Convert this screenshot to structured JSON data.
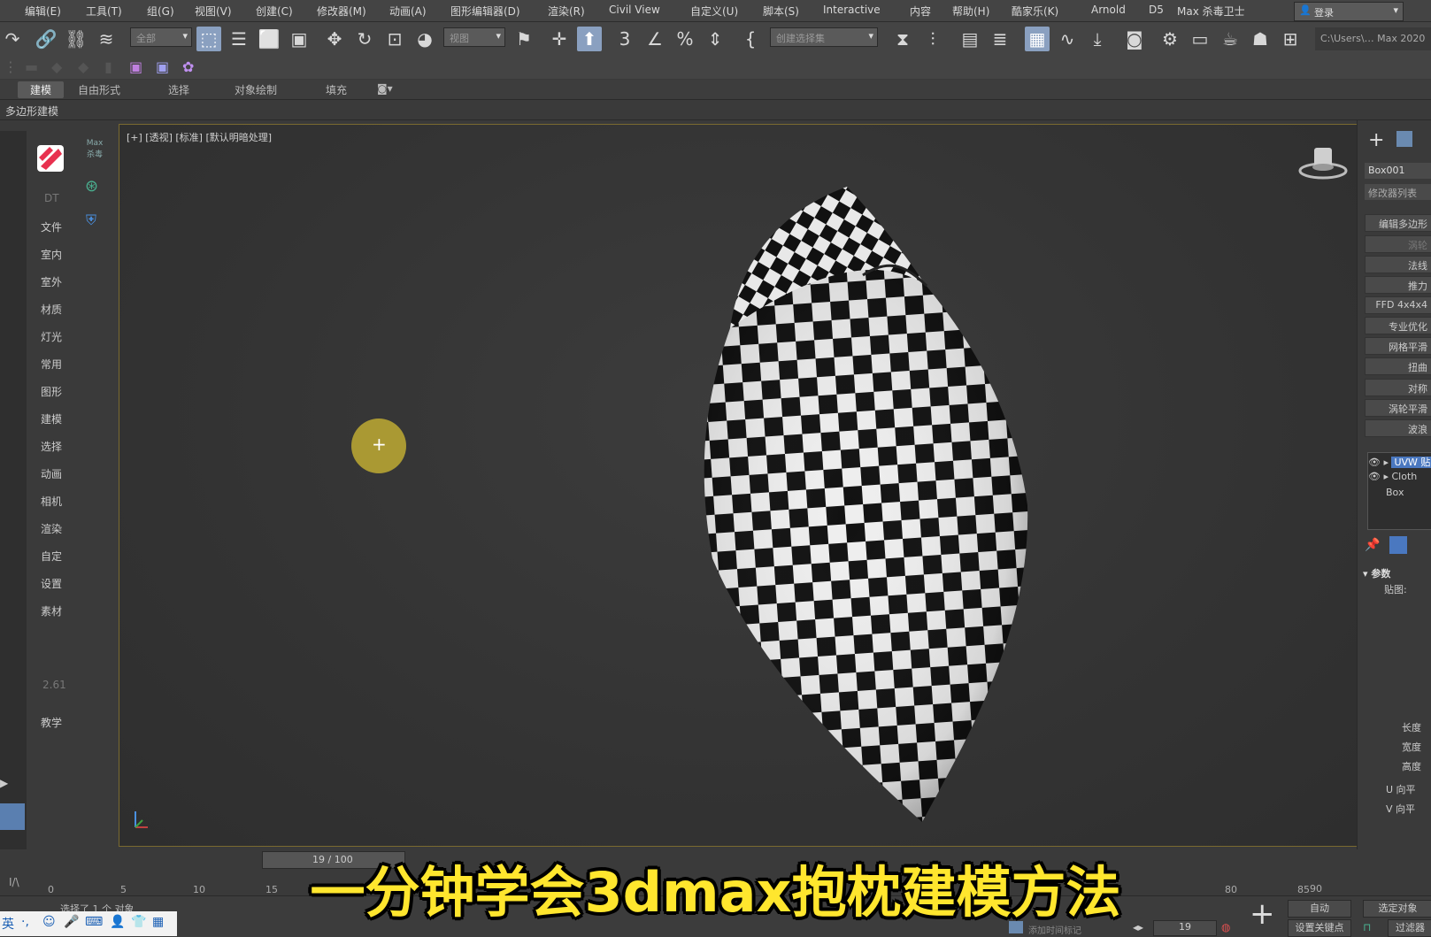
{
  "menu": [
    "编辑(E)",
    "工具(T)",
    "组(G)",
    "视图(V)",
    "创建(C)",
    "修改器(M)",
    "动画(A)",
    "图形编辑器(D)",
    "渲染(R)",
    "Civil View",
    "自定义(U)",
    "脚本(S)",
    "Interactive",
    "内容",
    "帮助(H)",
    "酷家乐(K)",
    "Arnold",
    "D5",
    "Max 杀毒卫士"
  ],
  "login_label": "登录",
  "toolbar": {
    "filter_value": "全部",
    "coord_value": "视图",
    "selection_set_value": "创建选择集",
    "path_value": "C:\\Users\\… Max 2020"
  },
  "ribbon_tabs": [
    "建模",
    "自由形式",
    "选择",
    "对象绘制",
    "填充"
  ],
  "ribbon_sub": "多边形建模",
  "left_panel": {
    "items": [
      "DT",
      "文件",
      "室内",
      "室外",
      "材质",
      "灯光",
      "常用",
      "图形",
      "建模",
      "选择",
      "动画",
      "相机",
      "渲染",
      "自定",
      "设置",
      "素材",
      "2.61",
      "教学"
    ],
    "logo_caption": "Max 杀毒"
  },
  "viewport": {
    "label": "[+] [透视] [标准] [默认明暗处理]"
  },
  "right_panel": {
    "object_name": "Box001",
    "modifier_list": "修改器列表",
    "buttons": [
      "编辑多边形",
      "涡轮",
      "法线",
      "推力",
      "FFD 4x4x4",
      "专业优化",
      "网格平滑",
      "扭曲",
      "对称",
      "涡轮平滑",
      "波浪"
    ],
    "stack": [
      "UVW 贴图",
      "Cloth",
      "Box"
    ],
    "rollout_title": "参数",
    "mapping_label": "贴图:",
    "param_labels": [
      "长度",
      "宽度",
      "高度",
      "U 向平",
      "V 向平"
    ]
  },
  "timeline": {
    "frame_display": "19 / 100",
    "ticks": [
      "0",
      "5",
      "10",
      "15",
      "80",
      "85",
      "90"
    ]
  },
  "status": {
    "selection_text": "选择了 1 个 对象",
    "add_time_tag": "添加时间标记",
    "current_frame": "19",
    "auto_key": "自动",
    "selected_label": "选定对象",
    "set_key": "设置关键点",
    "filter": "过滤器"
  },
  "caption": "一分钟学会3dmax抱枕建模方法",
  "ime": [
    "英",
    "·,",
    "☺",
    "🎤",
    "⌨",
    "👤",
    "👕",
    "▦"
  ]
}
